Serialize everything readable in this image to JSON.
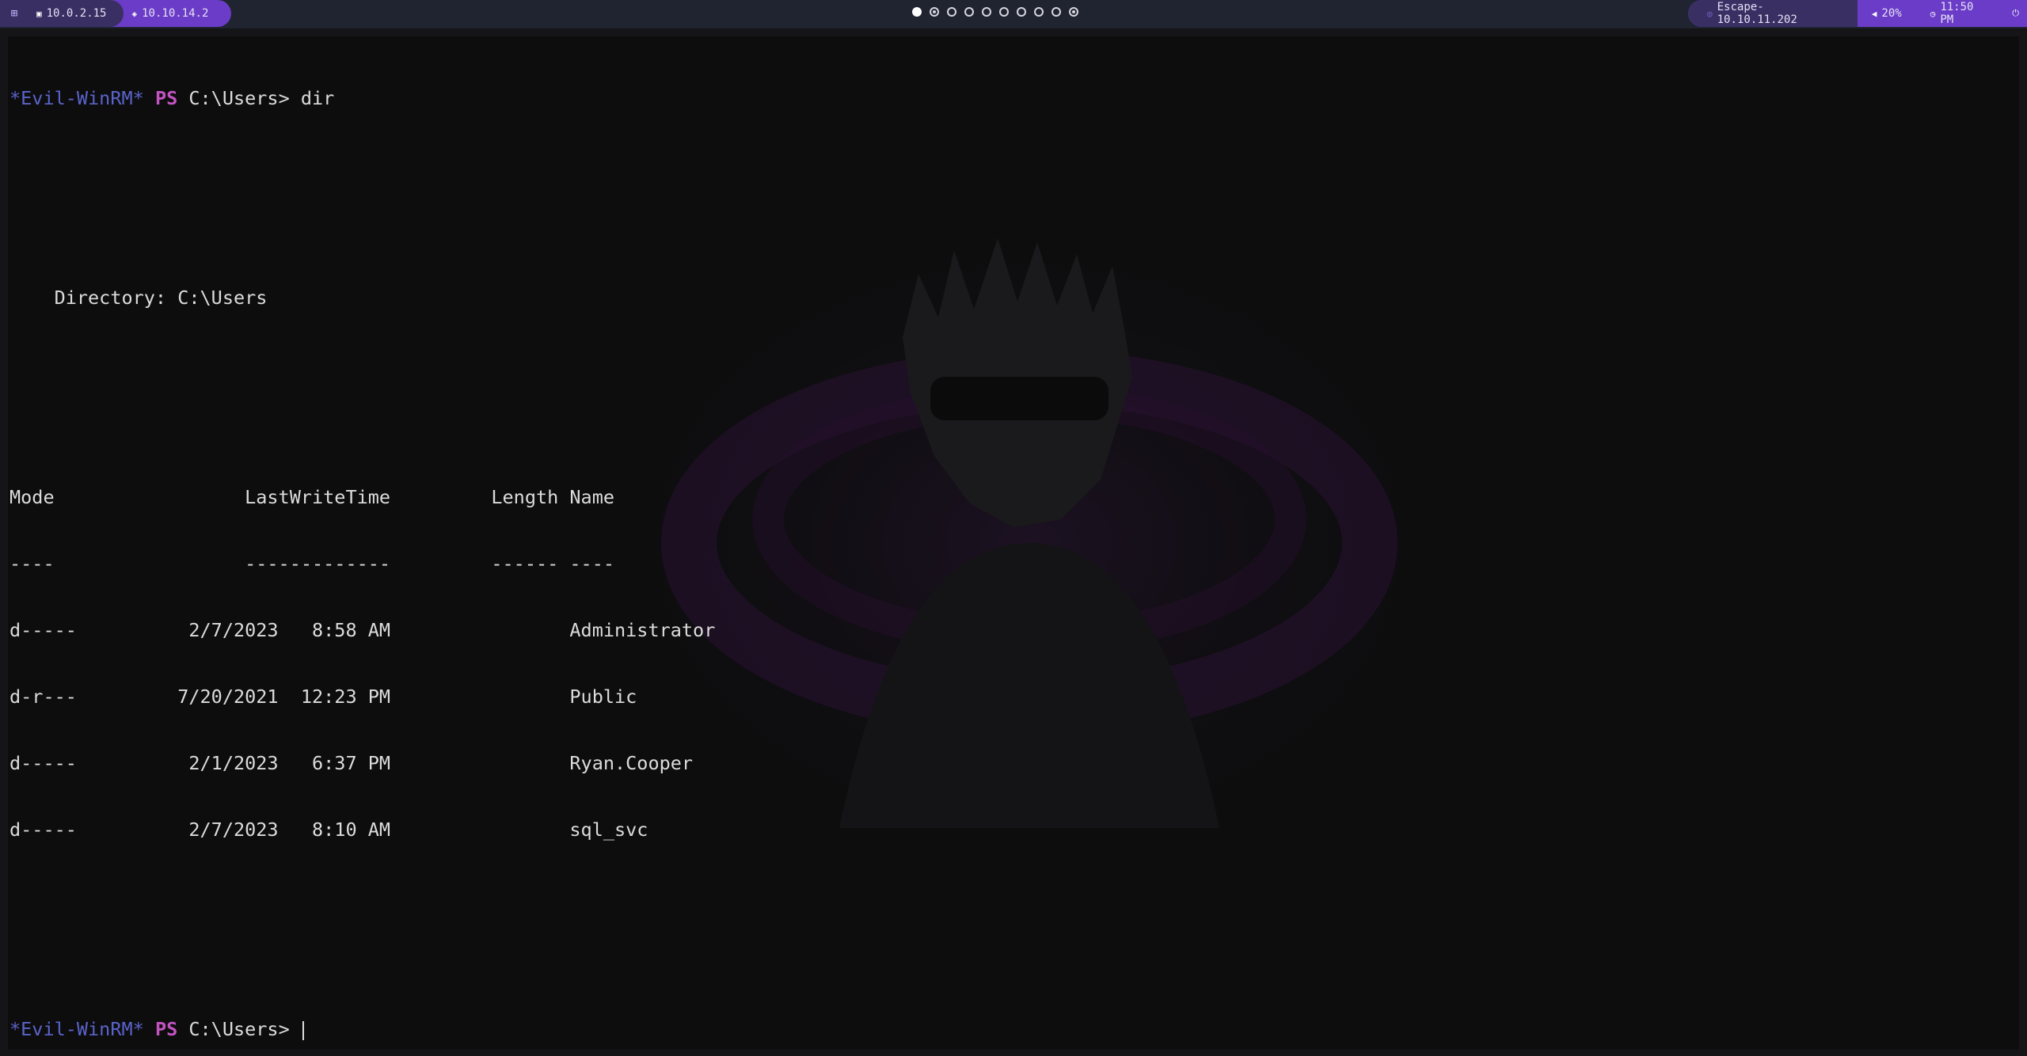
{
  "topbar": {
    "apps_icon": "grid-icon",
    "ip_local": "10.0.2.15",
    "ip_local_icon": "monitor-icon",
    "ip_vpn": "10.10.14.2",
    "ip_vpn_icon": "shield-icon",
    "workspaces": [
      {
        "state": "active"
      },
      {
        "state": "occupied"
      },
      {
        "state": "empty"
      },
      {
        "state": "empty"
      },
      {
        "state": "empty"
      },
      {
        "state": "empty"
      },
      {
        "state": "empty"
      },
      {
        "state": "empty"
      },
      {
        "state": "empty"
      },
      {
        "state": "occupied"
      }
    ],
    "target": "Escape-10.10.11.202",
    "target_icon": "target-icon",
    "volume": "20%",
    "volume_icon": "speaker-icon",
    "clock": "11:50 PM",
    "clock_icon": "clock-icon",
    "power_icon": "power-icon"
  },
  "terminal": {
    "prompt_tag": "*Evil-WinRM*",
    "prompt_ps": "PS",
    "prompt_path": "C:\\Users>",
    "command": "dir",
    "directory_line": "    Directory: C:\\Users",
    "header_line": "Mode                 LastWriteTime         Length Name",
    "separator_line": "----                 -------------         ------ ----",
    "rows": [
      "d-----          2/7/2023   8:58 AM                Administrator",
      "d-r---         7/20/2021  12:23 PM                Public",
      "d-----          2/1/2023   6:37 PM                Ryan.Cooper",
      "d-----          2/7/2023   8:10 AM                sql_svc"
    ]
  },
  "colors": {
    "bar_bg": "#1f2430",
    "accent_purple": "#6a3cc7",
    "accent_dark": "#3a2f63",
    "prompt_tag": "#5a63c9",
    "prompt_ps": "#c453c2",
    "terminal_bg": "#0d0d0e",
    "text": "#dcdcdc"
  }
}
